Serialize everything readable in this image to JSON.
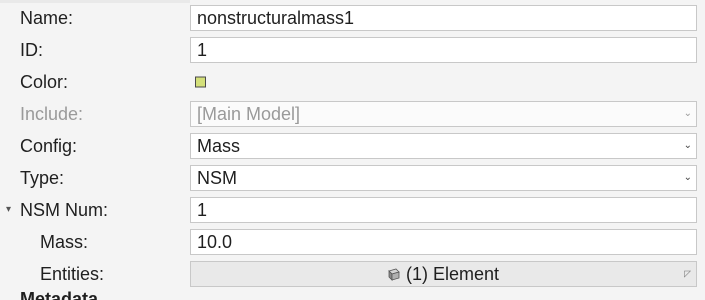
{
  "properties": {
    "name": {
      "label": "Name:",
      "value": "nonstructuralmass1"
    },
    "id": {
      "label": "ID:",
      "value": "1"
    },
    "color": {
      "label": "Color:",
      "swatch": "#d4e07a"
    },
    "include": {
      "label": "Include:",
      "value": "[Main Model]",
      "disabled": true
    },
    "config": {
      "label": "Config:",
      "value": "Mass"
    },
    "type": {
      "label": "Type:",
      "value": "NSM"
    },
    "nsm_num": {
      "label": "NSM Num:",
      "value": "1",
      "expanded": true
    },
    "mass": {
      "label": "Mass:",
      "value": "10.0"
    },
    "entities": {
      "label": "Entities:",
      "value": "(1) Element",
      "icon": "element-icon"
    }
  },
  "section_heading": "Metadata",
  "icons": {
    "dropdown": "chevron-down-icon",
    "expand": "expand-toggle-icon",
    "element": "element-icon",
    "corner": "corner-indicator-icon"
  }
}
